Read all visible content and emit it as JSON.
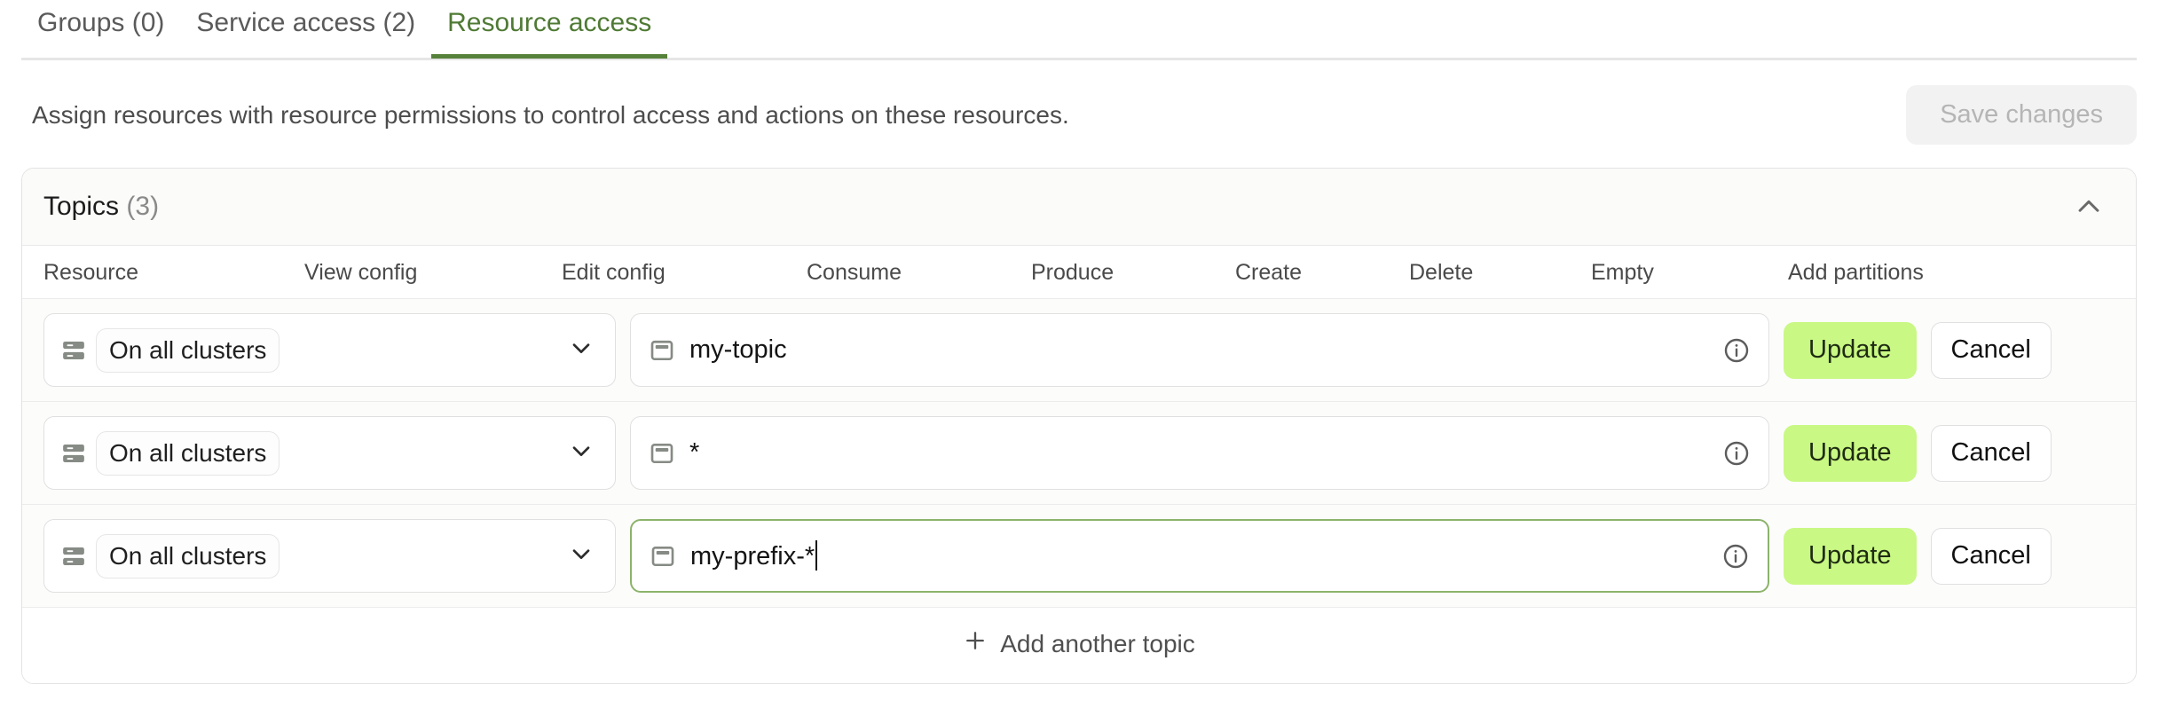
{
  "tabs": [
    {
      "label": "Groups (0)",
      "active": false
    },
    {
      "label": "Service access (2)",
      "active": false
    },
    {
      "label": "Resource access",
      "active": true
    }
  ],
  "header": {
    "description": "Assign resources with resource permissions to control access and actions on these resources.",
    "save_label": "Save changes",
    "save_disabled": true
  },
  "panel": {
    "title": "Topics",
    "count": "(3)",
    "collapse_icon": "chevron-up-icon",
    "columns": [
      "Resource",
      "View config",
      "Edit config",
      "Consume",
      "Produce",
      "Create",
      "Delete",
      "Empty",
      "Add partitions"
    ],
    "rows": [
      {
        "cluster_icon": "server-rack-icon",
        "cluster_scope": "On all clusters",
        "select_icon": "chevron-down-icon",
        "topic_icon": "topic-icon",
        "topic_value": "my-topic",
        "focused": false,
        "info_icon": "info-circle-icon",
        "update_label": "Update",
        "cancel_label": "Cancel"
      },
      {
        "cluster_icon": "server-rack-icon",
        "cluster_scope": "On all clusters",
        "select_icon": "chevron-down-icon",
        "topic_icon": "topic-icon",
        "topic_value": "*",
        "focused": false,
        "info_icon": "info-circle-icon",
        "update_label": "Update",
        "cancel_label": "Cancel"
      },
      {
        "cluster_icon": "server-rack-icon",
        "cluster_scope": "On all clusters",
        "select_icon": "chevron-down-icon",
        "topic_icon": "topic-icon",
        "topic_value": "my-prefix-*",
        "focused": true,
        "info_icon": "info-circle-icon",
        "update_label": "Update",
        "cancel_label": "Cancel"
      }
    ],
    "footer": {
      "add_icon": "plus-icon",
      "add_label": "Add another topic"
    }
  },
  "colors": {
    "accent_green": "#55813a",
    "update_lime": "#c9f884",
    "focus_border": "#8cb36a",
    "muted_text": "#8a8a8a"
  }
}
